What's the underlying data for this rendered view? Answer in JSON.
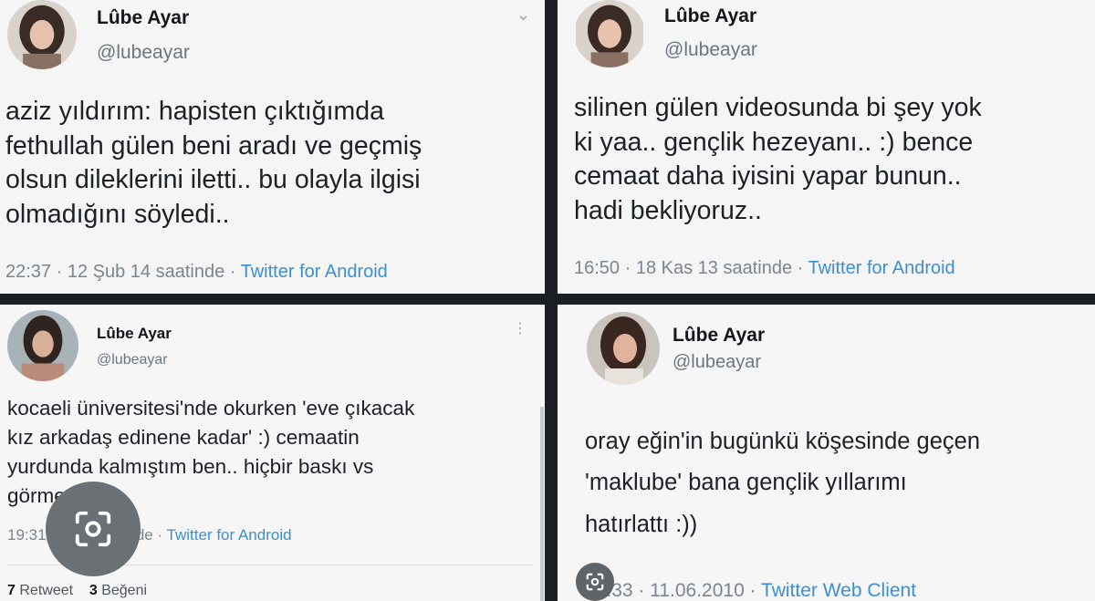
{
  "tweets": [
    {
      "name": "Lûbe Ayar",
      "handle": "@lubeayar",
      "text_lines": [
        "aziz yıldırım: hapisten çıktığımda",
        "fethullah gülen beni aradı ve geçmiş",
        "olsun dileklerini iletti.. bu olayla ilgisi",
        "olmadığını söyledi.."
      ],
      "meta": "22:37 · 12 Şub 14 saatinde · ",
      "client": "Twitter for Android",
      "menu_icon": "chevron-down-icon"
    },
    {
      "name": "Lûbe Ayar",
      "handle": "@lubeayar",
      "text_lines": [
        "silinen gülen videosunda bi şey yok",
        "ki yaa.. gençlik hezeyanı.. :) bence",
        "cemaat daha iyisini yapar bunun..",
        "hadi bekliyoruz.."
      ],
      "meta": "16:50 · 18 Kas 13 saatinde · ",
      "client": "Twitter for Android"
    },
    {
      "name": "Lûbe Ayar",
      "handle": "@lubeayar",
      "text_lines": [
        "kocaeli üniversitesi'nde okurken 'eve çıkacak",
        "kız arkadaş edinene kadar' :) cemaatin",
        "yurdunda kalmıştım ben.. hiçbir baskı vs",
        "görmedim.."
      ],
      "meta": "19:31 · 1 13 saatinde · ",
      "client": "Twitter for Android",
      "retweets": "7",
      "retweets_label": "Retweet",
      "likes": "3",
      "likes_label": "Beğeni",
      "menu_icon": "more-vertical-icon"
    },
    {
      "name": "Lûbe Ayar",
      "handle": "@lubeayar",
      "text_lines": [
        "oray eğin'in bugünkü köşesinde geçen",
        "'maklube' bana gençlik yıllarımı",
        "hatırlattı :))"
      ],
      "meta": "13:33 · 11.06.2010 · ",
      "client": "Twitter Web Client"
    }
  ],
  "overlay": {
    "search_image_icon": "image-search-icon"
  },
  "colors": {
    "link": "#3b8fd6",
    "separator": "#1b1f24",
    "lens_button": "#6a7074"
  }
}
